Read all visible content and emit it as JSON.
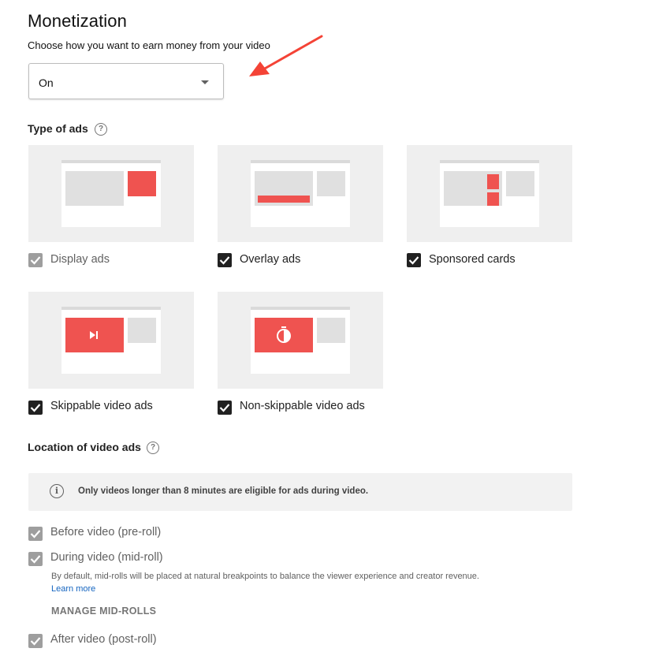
{
  "header": {
    "title": "Monetization",
    "subtitle": "Choose how you want to earn money from your video"
  },
  "monetization_select": {
    "value": "On"
  },
  "annotation": {
    "arrow_color": "#f44336"
  },
  "type_of_ads": {
    "label": "Type of ads",
    "help_icon": "?",
    "items": [
      {
        "label": "Display ads",
        "checked": true,
        "disabled": true
      },
      {
        "label": "Overlay ads",
        "checked": true,
        "disabled": false
      },
      {
        "label": "Sponsored cards",
        "checked": true,
        "disabled": false
      },
      {
        "label": "Skippable video ads",
        "checked": true,
        "disabled": false
      },
      {
        "label": "Non-skippable video ads",
        "checked": true,
        "disabled": false
      }
    ]
  },
  "location": {
    "label": "Location of video ads",
    "help_icon": "?",
    "info_icon": "i",
    "info_text": "Only videos longer than 8 minutes are eligible for ads during video.",
    "options": [
      {
        "label": "Before video (pre-roll)",
        "checked": true,
        "disabled": true
      },
      {
        "label": "During video (mid-roll)",
        "checked": true,
        "disabled": true
      },
      {
        "label": "After video (post-roll)",
        "checked": true,
        "disabled": true
      }
    ],
    "midroll_help": "By default, mid-rolls will be placed at natural breakpoints to balance the viewer experience and creator revenue.",
    "learn_more": "Learn more",
    "manage_button": "MANAGE MID-ROLLS"
  },
  "colors": {
    "accent_red": "#ef5350",
    "checkbox_dark": "#212121",
    "checkbox_disabled": "#9e9e9e",
    "link_blue": "#1565c0"
  }
}
